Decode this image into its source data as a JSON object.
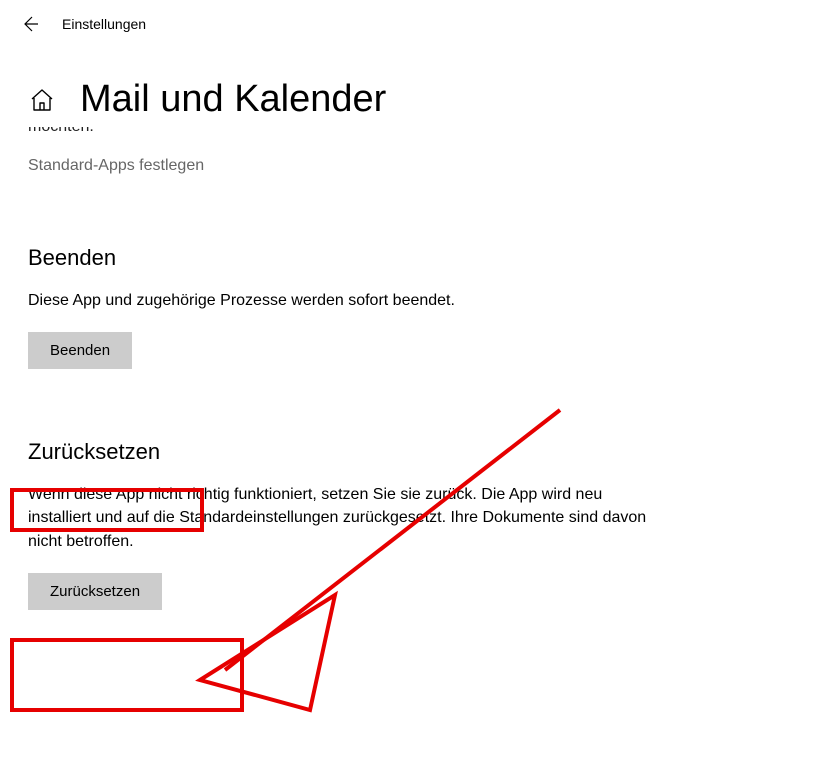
{
  "titlebar": {
    "window_title": "Einstellungen"
  },
  "page": {
    "title": "Mail und Kalender",
    "truncated_fragment": "möchten.",
    "default_apps_link": "Standard-Apps festlegen"
  },
  "terminate": {
    "heading": "Beenden",
    "description": "Diese App und zugehörige Prozesse werden sofort beendet.",
    "button_label": "Beenden"
  },
  "reset": {
    "heading": "Zurücksetzen",
    "description": "Wenn diese App nicht richtig funktioniert, setzen Sie sie zurück. Die App wird neu installiert und auf die Standardeinstellungen zurückgesetzt. Ihre Dokumente sind davon nicht betroffen.",
    "button_label": "Zurücksetzen"
  },
  "annotation": {
    "color": "#e60000"
  }
}
